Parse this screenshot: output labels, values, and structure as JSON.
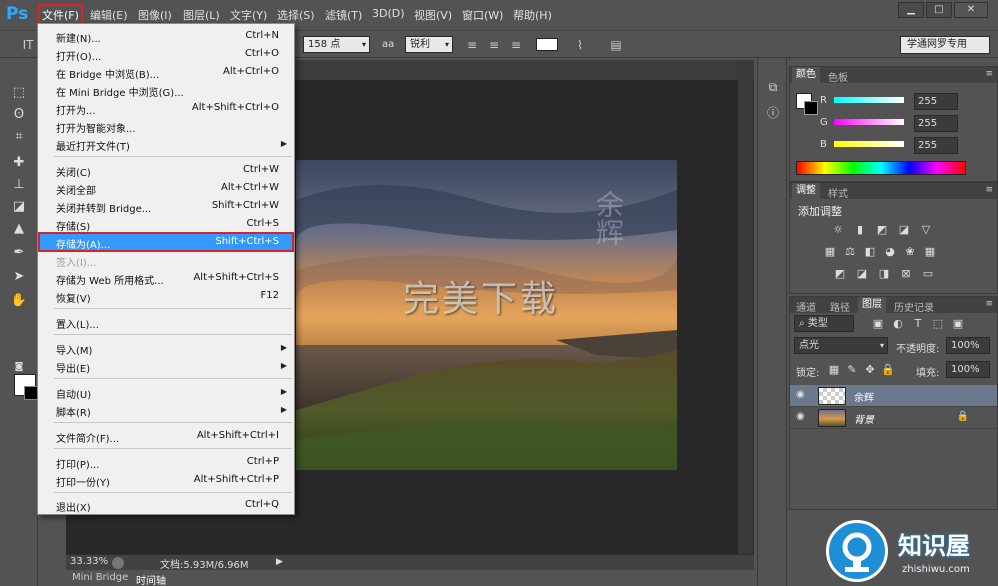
{
  "app": {
    "logo": "Ps"
  },
  "menubar": [
    {
      "label": "文件(F)"
    },
    {
      "label": "编辑(E)"
    },
    {
      "label": "图像(I)"
    },
    {
      "label": "图层(L)"
    },
    {
      "label": "文字(Y)"
    },
    {
      "label": "选择(S)"
    },
    {
      "label": "滤镜(T)"
    },
    {
      "label": "3D(D)"
    },
    {
      "label": "视图(V)"
    },
    {
      "label": "窗口(W)"
    },
    {
      "label": "帮助(H)"
    }
  ],
  "options": {
    "font_size": "158 点",
    "aa_icon": "aa",
    "antialias": "锐利",
    "workspace": "学通网罗专用"
  },
  "file_menu": [
    {
      "label": "新建(N)...",
      "shortcut": "Ctrl+N"
    },
    {
      "label": "打开(O)...",
      "shortcut": "Ctrl+O"
    },
    {
      "label": "在 Bridge 中浏览(B)...",
      "shortcut": "Alt+Ctrl+O"
    },
    {
      "label": "在 Mini Bridge 中浏览(G)...",
      "shortcut": ""
    },
    {
      "label": "打开为...",
      "shortcut": "Alt+Shift+Ctrl+O"
    },
    {
      "label": "打开为智能对象...",
      "shortcut": ""
    },
    {
      "label": "最近打开文件(T)",
      "shortcut": ""
    },
    {
      "label": "关闭(C)",
      "shortcut": "Ctrl+W"
    },
    {
      "label": "关闭全部",
      "shortcut": "Alt+Ctrl+W"
    },
    {
      "label": "关闭并转到 Bridge...",
      "shortcut": "Shift+Ctrl+W"
    },
    {
      "label": "存储(S)",
      "shortcut": "Ctrl+S"
    },
    {
      "label": "存储为(A)...",
      "shortcut": "Shift+Ctrl+S"
    },
    {
      "label": "签入(I)...",
      "shortcut": ""
    },
    {
      "label": "存储为 Web 所用格式...",
      "shortcut": "Alt+Shift+Ctrl+S"
    },
    {
      "label": "恢复(V)",
      "shortcut": "F12"
    },
    {
      "label": "置入(L)...",
      "shortcut": ""
    },
    {
      "label": "导入(M)",
      "shortcut": ""
    },
    {
      "label": "导出(E)",
      "shortcut": ""
    },
    {
      "label": "自动(U)",
      "shortcut": ""
    },
    {
      "label": "脚本(R)",
      "shortcut": ""
    },
    {
      "label": "文件简介(F)...",
      "shortcut": "Alt+Shift+Ctrl+I"
    },
    {
      "label": "打印(P)...",
      "shortcut": "Ctrl+P"
    },
    {
      "label": "打印一份(Y)",
      "shortcut": "Alt+Shift+Ctrl+P"
    },
    {
      "label": "退出(X)",
      "shortcut": "Ctrl+Q"
    }
  ],
  "canvas": {
    "watermark_main": "完美下载",
    "watermark_side": "余辉"
  },
  "status": {
    "zoom": "33.33%",
    "doc": "文档:5.93M/6.96M"
  },
  "bottom_tabs": [
    "Mini Bridge",
    "时间轴"
  ],
  "color_panel": {
    "tabs": [
      "颜色",
      "色板"
    ],
    "channels": [
      {
        "label": "R",
        "value": "255"
      },
      {
        "label": "G",
        "value": "255"
      },
      {
        "label": "B",
        "value": "255"
      }
    ]
  },
  "adjust_panel": {
    "tabs": [
      "调整",
      "样式"
    ],
    "title": "添加调整"
  },
  "layers_panel": {
    "tabs": [
      "通道",
      "路径",
      "图层",
      "历史记录"
    ],
    "kind": "类型",
    "blend_mode": "点光",
    "opacity_label": "不透明度:",
    "opacity": "100%",
    "lock_label": "锁定:",
    "fill_label": "填充:",
    "fill": "100%",
    "layers": [
      {
        "name": "余辉"
      },
      {
        "name": "背景"
      }
    ]
  },
  "badge": {
    "title": "知识屋",
    "url": "zhishiwu.com"
  },
  "colors": {
    "accent_red": "#d8222a",
    "highlight_blue": "#3399ff",
    "ps_blue": "#31a8ff"
  }
}
